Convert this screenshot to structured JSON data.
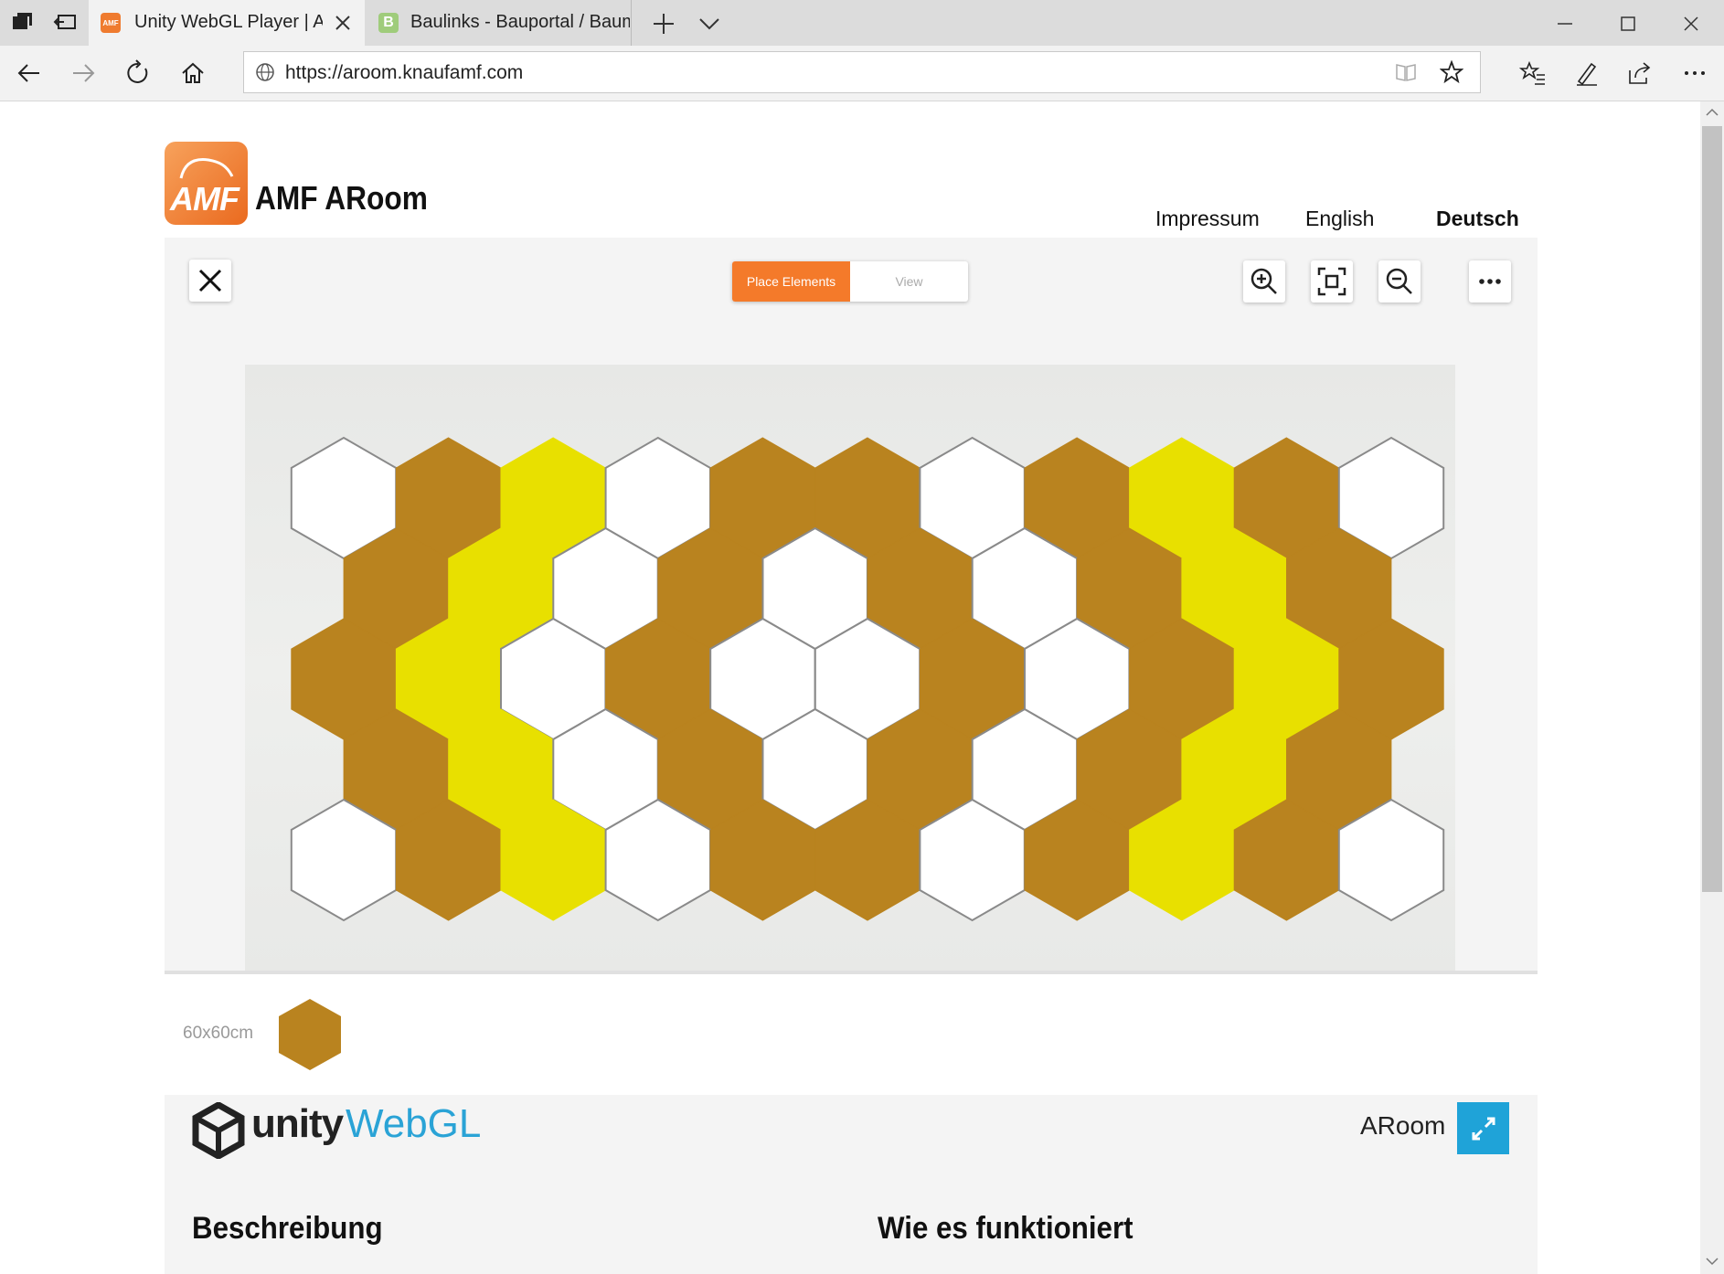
{
  "browser": {
    "tabs": [
      {
        "title": "Unity WebGL Player | AF",
        "favicon_text": "AMF",
        "active": true
      },
      {
        "title": "Baulinks - Bauportal / Baum",
        "favicon_text": "B",
        "active": false
      }
    ],
    "url": "https://aroom.knaufamf.com"
  },
  "header": {
    "logo_text": "AMF",
    "site_title": "AMF ARoom",
    "nav": [
      "Impressum",
      "English",
      "Deutsch"
    ],
    "active_nav": "Deutsch"
  },
  "toolbar": {
    "mode_active": "Place Elements",
    "mode_inactive": "View"
  },
  "tiles": {
    "colors": {
      "white": "#ffffff",
      "brown": "#b9831f",
      "yellow": "#e8e000",
      "outline": "#8a8a8a"
    },
    "rows": [
      [
        "white",
        "brown",
        "yellow",
        "white",
        "brown",
        "brown",
        "white",
        "brown",
        "yellow",
        "brown",
        "white"
      ],
      [
        "brown",
        "yellow",
        "white",
        "brown",
        "white",
        "brown",
        "white",
        "brown",
        "yellow",
        "brown"
      ],
      [
        "brown",
        "yellow",
        "white",
        "brown",
        "white",
        "white",
        "brown",
        "white",
        "brown",
        "yellow",
        "brown"
      ],
      [
        "brown",
        "yellow",
        "white",
        "brown",
        "white",
        "brown",
        "white",
        "brown",
        "yellow",
        "brown"
      ],
      [
        "white",
        "brown",
        "yellow",
        "white",
        "brown",
        "brown",
        "white",
        "brown",
        "yellow",
        "brown",
        "white"
      ]
    ]
  },
  "palette": {
    "size_label": "60x60cm",
    "tile_color": "#b9831f"
  },
  "footer": {
    "unity_text": "unity",
    "webgl_text": "WebGL",
    "app_name": "ARoom",
    "section_left": "Beschreibung",
    "section_right": "Wie es funktioniert"
  }
}
